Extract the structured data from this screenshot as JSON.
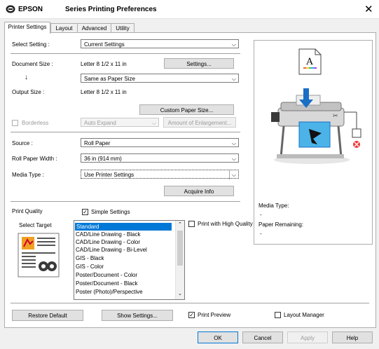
{
  "window": {
    "brand": "EPSON",
    "title": "Series Printing Preferences",
    "close": "✕"
  },
  "tabs": [
    "Printer Settings",
    "Layout",
    "Advanced",
    "Utility"
  ],
  "select_setting": {
    "label": "Select Setting :",
    "value": "Current Settings"
  },
  "document_size": {
    "label": "Document Size :",
    "value": "Letter 8 1/2 x 11 in",
    "button": "Settings...",
    "arrow": "↓",
    "same_as": "Same as Paper Size"
  },
  "output_size": {
    "label": "Output Size :",
    "value": "Letter 8 1/2 x 11 in",
    "button": "Custom Paper Size..."
  },
  "borderless": {
    "label": "Borderless",
    "auto_expand": "Auto Expand",
    "amount_button": "Amount of Enlargement..."
  },
  "source": {
    "label": "Source :",
    "value": "Roll Paper"
  },
  "roll_width": {
    "label": "Roll Paper Width :",
    "value": "36 in (914 mm)"
  },
  "media_type": {
    "label": "Media Type :",
    "value": "Use Printer Settings",
    "button": "Acquire Info"
  },
  "print_quality": {
    "label": "Print Quality",
    "simple_settings": "Simple Settings",
    "select_target": "Select Target",
    "high_quality": "Print with High Quality",
    "targets": [
      "Standard",
      "CAD/Line Drawing - Black",
      "CAD/Line Drawing - Color",
      "CAD/Line Drawing - Bi-Level",
      "GIS - Black",
      "GIS - Color",
      "Poster/Document - Color",
      "Poster/Document - Black",
      "Poster (Photo)/Perspective"
    ]
  },
  "status": {
    "media_type_label": "Media Type:",
    "media_type_value": "-",
    "paper_remaining_label": "Paper Remaining:",
    "paper_remaining_value": "-"
  },
  "bottom": {
    "restore": "Restore Default",
    "show_settings": "Show Settings...",
    "print_preview": "Print Preview",
    "layout_manager": "Layout Manager"
  },
  "footer": {
    "ok": "OK",
    "cancel": "Cancel",
    "apply": "Apply",
    "help": "Help"
  },
  "colors": {
    "accent": "#0078d7",
    "printer_blue": "#1a6fc4"
  }
}
